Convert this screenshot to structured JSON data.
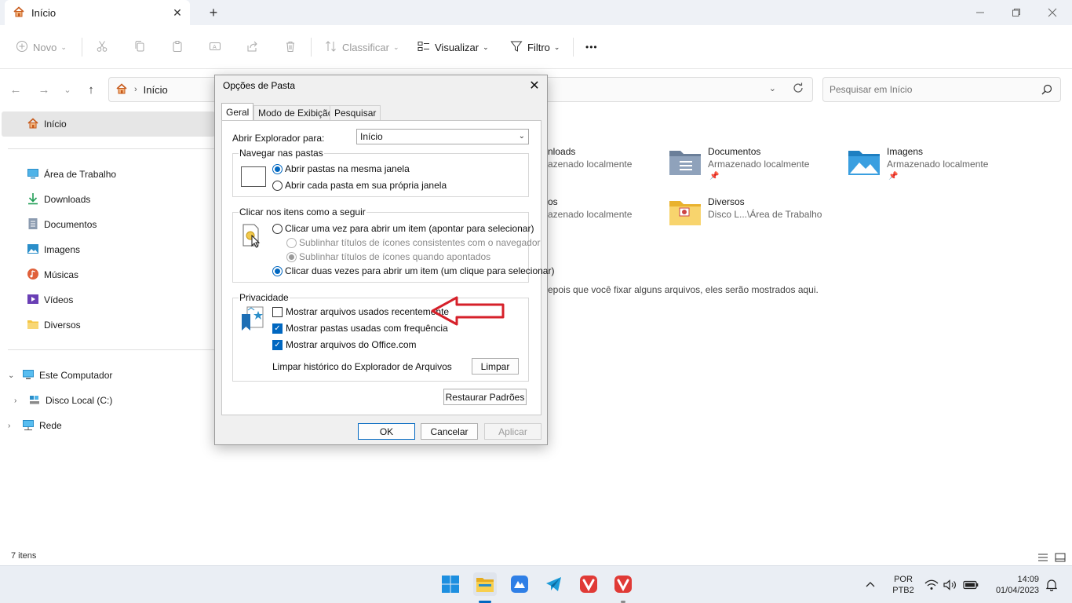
{
  "window": {
    "tab_title": "Início",
    "icons": {
      "tab": "home-icon",
      "close_tab": "close-icon",
      "new_tab": "plus-icon",
      "minimize": "minimize-icon",
      "maximize": "restore-icon",
      "close": "close-icon"
    }
  },
  "toolbar": {
    "new_label": "Novo",
    "sort_label": "Classificar",
    "view_label": "Visualizar",
    "filter_label": "Filtro",
    "more_label": "•••"
  },
  "address": {
    "crumb": "Início",
    "search_placeholder": "Pesquisar em Início"
  },
  "sidebar": {
    "home": "Início",
    "items": [
      {
        "label": "Área de Trabalho",
        "icon": "desktop-icon"
      },
      {
        "label": "Downloads",
        "icon": "download-icon"
      },
      {
        "label": "Documentos",
        "icon": "documents-icon"
      },
      {
        "label": "Imagens",
        "icon": "pictures-icon"
      },
      {
        "label": "Músicas",
        "icon": "music-icon"
      },
      {
        "label": "Vídeos",
        "icon": "videos-icon"
      },
      {
        "label": "Diversos",
        "icon": "folder-icon"
      }
    ],
    "tree": [
      {
        "label": "Este Computador",
        "expanded": true
      },
      {
        "label": "Disco Local (C:)",
        "expanded": false
      },
      {
        "label": "Rede",
        "expanded": false
      }
    ]
  },
  "quick_access": {
    "items": [
      {
        "title": "nloads",
        "subtitle": "azenado localmente"
      },
      {
        "title": "Documentos",
        "subtitle": "Armazenado localmente"
      },
      {
        "title": "Imagens",
        "subtitle": "Armazenado localmente"
      },
      {
        "title": "os",
        "subtitle": "azenado localmente"
      },
      {
        "title": "Diversos",
        "subtitle": "Disco L...\\Área de Trabalho"
      }
    ],
    "empty_message": "epois que você fixar alguns arquivos, eles serão mostrados aqui."
  },
  "status": {
    "count": "7 itens"
  },
  "dialog": {
    "title": "Opções de Pasta",
    "tabs": [
      "Geral",
      "Modo de Exibição",
      "Pesquisar"
    ],
    "open_explorer_label": "Abrir Explorador para:",
    "open_explorer_value": "Início",
    "browse_group": {
      "title": "Navegar nas pastas",
      "opt1": "Abrir pastas na mesma janela",
      "opt2": "Abrir cada pasta em sua própria janela"
    },
    "click_group": {
      "title": "Clicar nos itens como a seguir",
      "opt1": "Clicar uma vez para abrir um item (apontar para selecionar)",
      "sub1": "Sublinhar títulos de ícones consistentes com o navegador",
      "sub2": "Sublinhar títulos de ícones quando apontados",
      "opt2": "Clicar duas vezes para abrir um item (um clique para selecionar)"
    },
    "privacy_group": {
      "title": "Privacidade",
      "chk1": "Mostrar arquivos usados recentemente",
      "chk2": "Mostrar pastas usadas com frequência",
      "chk3": "Mostrar arquivos do Office.com",
      "clear_label": "Limpar histórico do Explorador de Arquivos",
      "clear_button": "Limpar"
    },
    "restore_button": "Restaurar Padrões",
    "ok_button": "OK",
    "cancel_button": "Cancelar",
    "apply_button": "Aplicar"
  },
  "taskbar": {
    "apps": [
      "windows-start-icon",
      "file-explorer-icon",
      "app-icon",
      "telegram-icon",
      "vivaldi-icon",
      "vivaldi-icon"
    ],
    "language": "POR",
    "layout": "PTB2",
    "time": "14:09",
    "date": "01/04/2023"
  },
  "colors": {
    "accent": "#0067c0",
    "annotation_arrow": "#d6202a"
  }
}
